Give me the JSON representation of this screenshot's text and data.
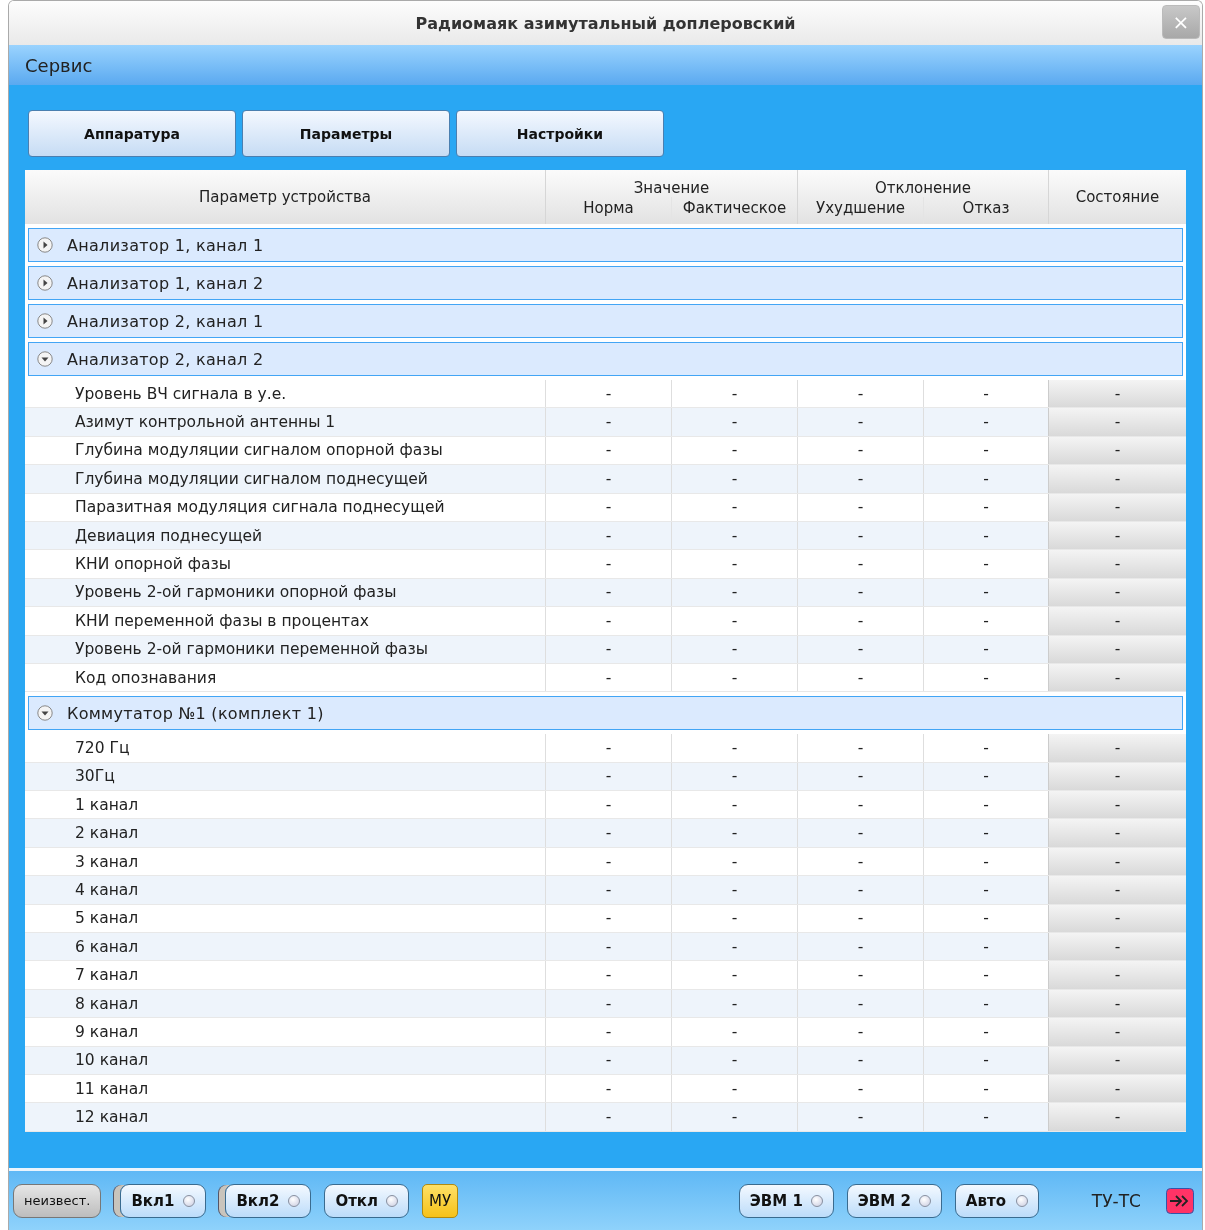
{
  "window": {
    "title": "Радиомаяк азимутальный доплеровский",
    "close": "×"
  },
  "menu": [
    "Сервис"
  ],
  "tabs": [
    "Аппаратура",
    "Параметры",
    "Настройки"
  ],
  "table": {
    "param_header": "Параметр устройства",
    "groups_header": [
      {
        "label": "Значение",
        "columns": [
          "Норма",
          "Фактическое"
        ]
      },
      {
        "label": "Отклонение",
        "columns": [
          "Ухудшение",
          "Отказ"
        ]
      }
    ],
    "state_header": "Состояние",
    "groups": [
      {
        "name": "Анализатор 1, канал 1",
        "expanded": false
      },
      {
        "name": "Анализатор 1, канал 2",
        "expanded": false
      },
      {
        "name": "Анализатор 2, канал 1",
        "expanded": false
      },
      {
        "name": "Анализатор 2, канал 2",
        "expanded": true,
        "rows": [
          {
            "name": "Уровень ВЧ сигнала в у.е.",
            "cells": [
              "-",
              "-",
              "-",
              "-",
              "-"
            ]
          },
          {
            "name": "Азимут контрольной антенны 1",
            "cells": [
              "-",
              "-",
              "-",
              "-",
              "-"
            ]
          },
          {
            "name": "Глубина модуляции сигналом опорной фазы",
            "cells": [
              "-",
              "-",
              "-",
              "-",
              "-"
            ]
          },
          {
            "name": "Глубина модуляции сигналом поднесущей",
            "cells": [
              "-",
              "-",
              "-",
              "-",
              "-"
            ]
          },
          {
            "name": "Паразитная модуляция сигнала поднесущей",
            "cells": [
              "-",
              "-",
              "-",
              "-",
              "-"
            ]
          },
          {
            "name": "Девиация поднесущей",
            "cells": [
              "-",
              "-",
              "-",
              "-",
              "-"
            ]
          },
          {
            "name": "КНИ опорной фазы",
            "cells": [
              "-",
              "-",
              "-",
              "-",
              "-"
            ]
          },
          {
            "name": "Уровень 2-ой гармоники опорной фазы",
            "cells": [
              "-",
              "-",
              "-",
              "-",
              "-"
            ]
          },
          {
            "name": "КНИ переменной фазы в процентах",
            "cells": [
              "-",
              "-",
              "-",
              "-",
              "-"
            ]
          },
          {
            "name": "Уровень 2-ой гармоники переменной фазы",
            "cells": [
              "-",
              "-",
              "-",
              "-",
              "-"
            ]
          },
          {
            "name": "Код опознавания",
            "cells": [
              "-",
              "-",
              "-",
              "-",
              "-"
            ]
          }
        ]
      },
      {
        "name": "Коммутатор №1 (комплект 1)",
        "expanded": true,
        "rows": [
          {
            "name": "720 Гц",
            "cells": [
              "-",
              "-",
              "-",
              "-",
              "-"
            ]
          },
          {
            "name": "30Гц",
            "cells": [
              "-",
              "-",
              "-",
              "-",
              "-"
            ]
          },
          {
            "name": "1 канал",
            "cells": [
              "-",
              "-",
              "-",
              "-",
              "-"
            ]
          },
          {
            "name": "2 канал",
            "cells": [
              "-",
              "-",
              "-",
              "-",
              "-"
            ]
          },
          {
            "name": "3 канал",
            "cells": [
              "-",
              "-",
              "-",
              "-",
              "-"
            ]
          },
          {
            "name": "4 канал",
            "cells": [
              "-",
              "-",
              "-",
              "-",
              "-"
            ]
          },
          {
            "name": "5 канал",
            "cells": [
              "-",
              "-",
              "-",
              "-",
              "-"
            ]
          },
          {
            "name": "6 канал",
            "cells": [
              "-",
              "-",
              "-",
              "-",
              "-"
            ]
          },
          {
            "name": "7 канал",
            "cells": [
              "-",
              "-",
              "-",
              "-",
              "-"
            ]
          },
          {
            "name": "8 канал",
            "cells": [
              "-",
              "-",
              "-",
              "-",
              "-"
            ]
          },
          {
            "name": "9 канал",
            "cells": [
              "-",
              "-",
              "-",
              "-",
              "-"
            ]
          },
          {
            "name": "10 канал",
            "cells": [
              "-",
              "-",
              "-",
              "-",
              "-"
            ]
          },
          {
            "name": "11 канал",
            "cells": [
              "-",
              "-",
              "-",
              "-",
              "-"
            ]
          },
          {
            "name": "12 канал",
            "cells": [
              "-",
              "-",
              "-",
              "-",
              "-"
            ]
          }
        ]
      }
    ]
  },
  "status_bar": {
    "left": [
      {
        "kind": "plain",
        "label": "неизвест."
      },
      {
        "kind": "stacked",
        "label": "Вкл1",
        "lit": false
      },
      {
        "kind": "stacked",
        "label": "Вкл2",
        "lit": false
      },
      {
        "kind": "toggle",
        "label": "Откл",
        "lit": false
      },
      {
        "kind": "flag",
        "label": "МУ"
      }
    ],
    "right": [
      {
        "kind": "toggle",
        "label": "ЭВМ 1",
        "lit": false
      },
      {
        "kind": "toggle",
        "label": "ЭВМ 2",
        "lit": false
      },
      {
        "kind": "toggle",
        "label": "Авто",
        "lit": false
      }
    ],
    "link_label": "ТУ-ТС"
  }
}
